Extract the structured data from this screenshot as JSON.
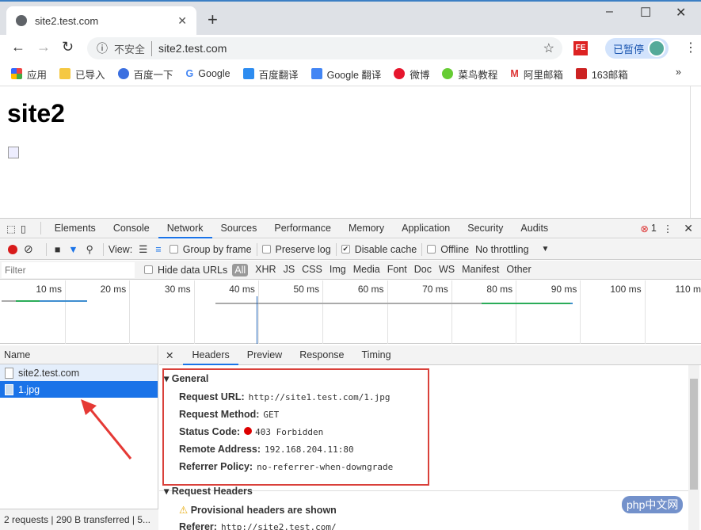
{
  "browser": {
    "tab_title": "site2.test.com",
    "insecure_label": "不安全",
    "url": "site2.test.com",
    "paused_label": "已暂停",
    "ext_label": "FE",
    "bookmarks": [
      {
        "label": "应用",
        "color": "#e44"
      },
      {
        "label": "已导入",
        "color": "#f5c842"
      },
      {
        "label": "百度一下",
        "color": "#3b6fe0"
      },
      {
        "label": "Google",
        "color": "#4285f4"
      },
      {
        "label": "百度翻译",
        "color": "#2d8cf0"
      },
      {
        "label": "Google 翻译",
        "color": "#4285f4"
      },
      {
        "label": "微博",
        "color": "#e6162d"
      },
      {
        "label": "菜鸟教程",
        "color": "#6c3"
      },
      {
        "label": "阿里邮箱",
        "color": "#d33"
      },
      {
        "label": "163邮箱",
        "color": "#c22"
      }
    ],
    "more": "»"
  },
  "page": {
    "heading": "site2"
  },
  "devtools": {
    "tabs": [
      "Elements",
      "Console",
      "Network",
      "Sources",
      "Performance",
      "Memory",
      "Application",
      "Security",
      "Audits"
    ],
    "active_tab": "Network",
    "error_count": "1",
    "toolbar": {
      "view_label": "View:",
      "group_by_frame": "Group by frame",
      "preserve_log": "Preserve log",
      "disable_cache": "Disable cache",
      "disable_cache_checked": true,
      "offline": "Offline",
      "throttling": "No throttling"
    },
    "filter": {
      "placeholder": "Filter",
      "hide_data_urls": "Hide data URLs",
      "types": [
        "All",
        "XHR",
        "JS",
        "CSS",
        "Img",
        "Media",
        "Font",
        "Doc",
        "WS",
        "Manifest",
        "Other"
      ],
      "active_type": "All"
    },
    "timeline_ticks": [
      "10 ms",
      "20 ms",
      "30 ms",
      "40 ms",
      "50 ms",
      "60 ms",
      "70 ms",
      "80 ms",
      "90 ms",
      "100 ms",
      "110 ms"
    ],
    "list": {
      "header": "Name",
      "items": [
        {
          "name": "site2.test.com",
          "selected": false
        },
        {
          "name": "1.jpg",
          "selected": true
        }
      ]
    },
    "status_bar": "2 requests | 290 B transferred | 5...",
    "detail": {
      "tabs": [
        "Headers",
        "Preview",
        "Response",
        "Timing"
      ],
      "active_tab": "Headers",
      "general_title": "General",
      "general": [
        {
          "key": "Request URL:",
          "value": "http://site1.test.com/1.jpg"
        },
        {
          "key": "Request Method:",
          "value": "GET"
        },
        {
          "key": "Status Code:",
          "value": "403 Forbidden"
        },
        {
          "key": "Remote Address:",
          "value": "192.168.204.11:80"
        },
        {
          "key": "Referrer Policy:",
          "value": "no-referrer-when-downgrade"
        }
      ],
      "request_headers_title": "Request Headers",
      "provisional": "Provisional headers are shown",
      "referer_key": "Referer:",
      "referer_value": "http://site2.test.com/"
    }
  },
  "watermark": "php中文网"
}
